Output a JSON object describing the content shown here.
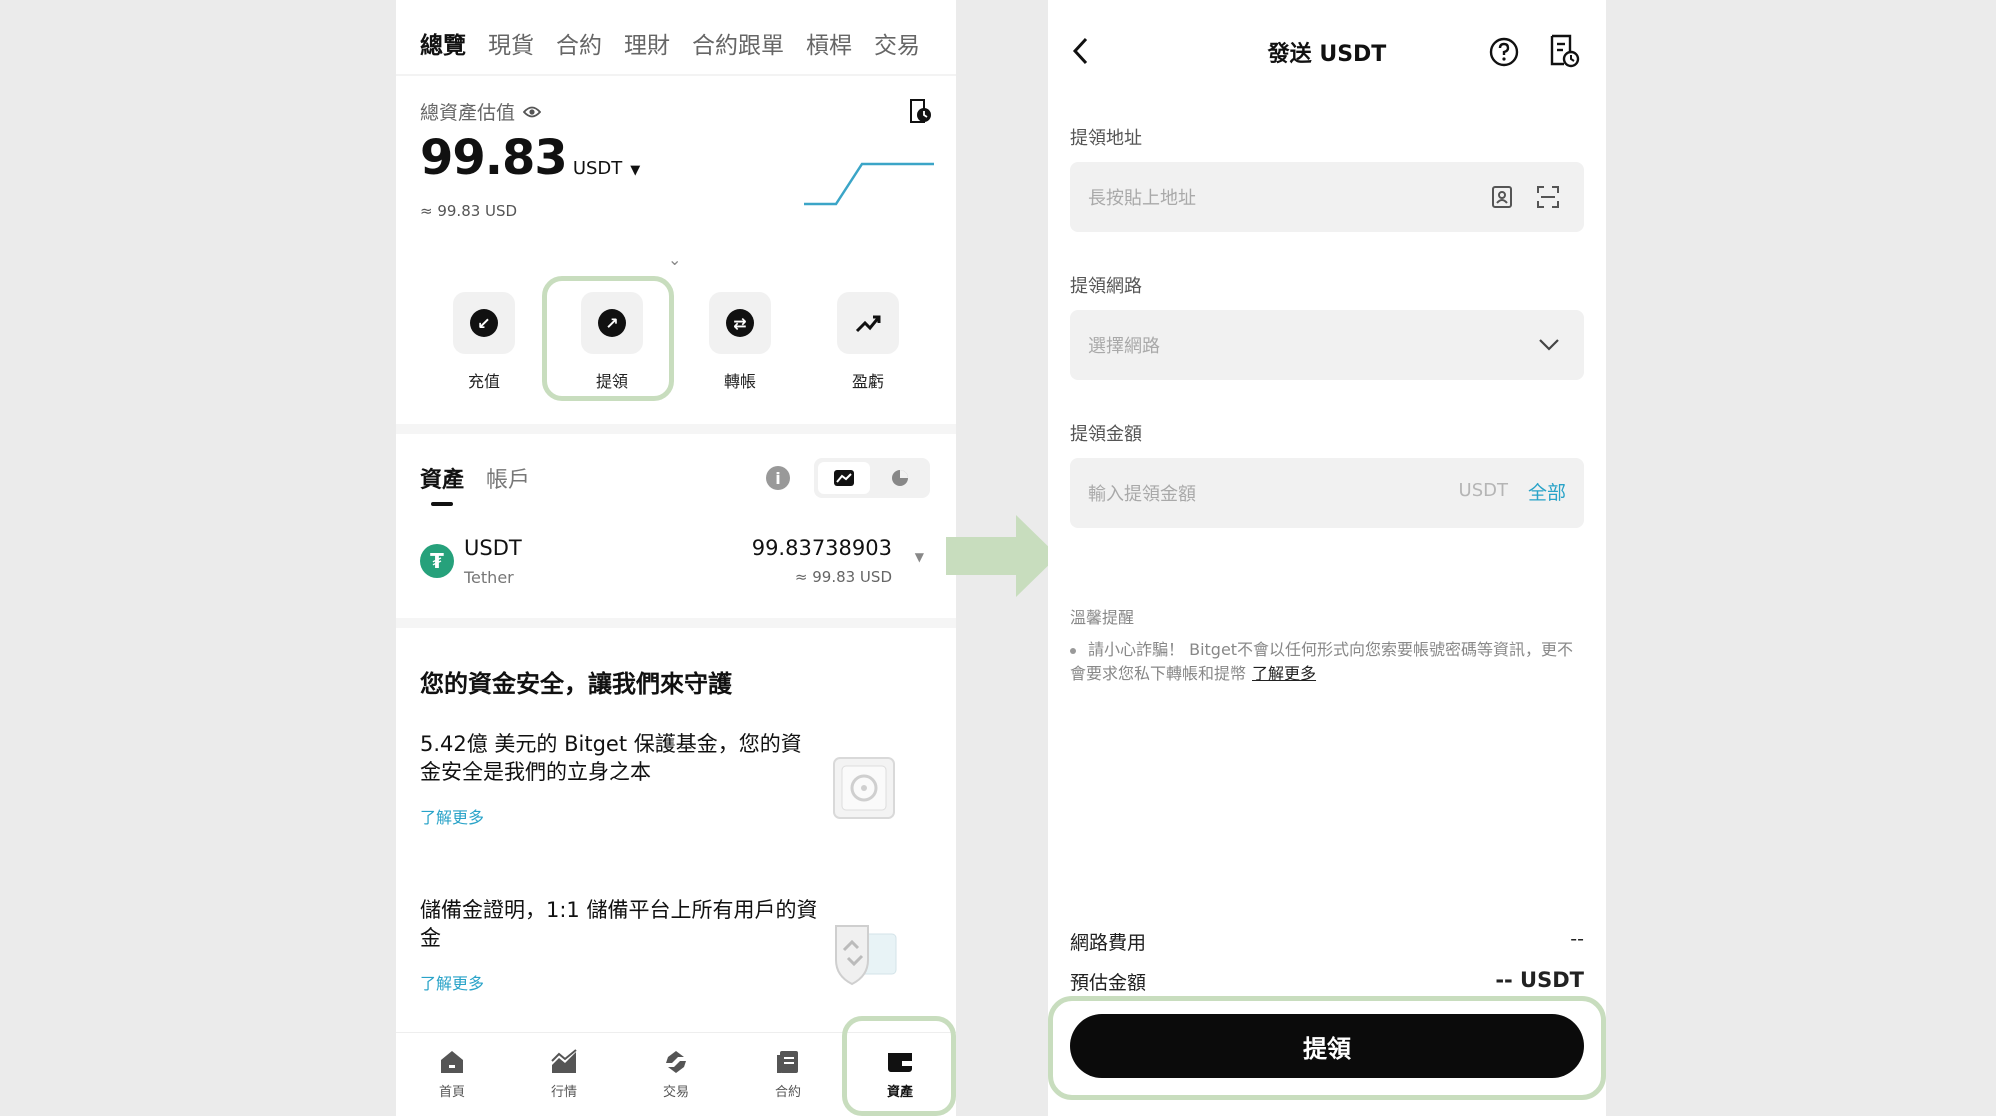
{
  "left": {
    "top_tabs": [
      "總覽",
      "現貨",
      "合約",
      "理財",
      "合約跟單",
      "槓桿",
      "交易"
    ],
    "active_top_tab": "總覽",
    "estimate_label": "總資產估值",
    "balance": "99.83",
    "balance_unit": "USDT",
    "balance_approx": "≈ 99.83 USD",
    "actions": [
      {
        "label": "充值",
        "icon": "deposit-icon"
      },
      {
        "label": "提領",
        "icon": "withdraw-icon"
      },
      {
        "label": "轉帳",
        "icon": "transfer-icon"
      },
      {
        "label": "盈虧",
        "icon": "pnl-icon"
      }
    ],
    "section_tabs": [
      "資產",
      "帳戶"
    ],
    "asset": {
      "symbol": "USDT",
      "name": "Tether",
      "amount": "99.83738903",
      "usd": "≈ 99.83 USD"
    },
    "safety_title": "您的資金安全，讓我們來守護",
    "features": [
      {
        "text": "5.42億 美元的 Bitget 保護基金，您的資金安全是我們的立身之本",
        "more": "了解更多"
      },
      {
        "text": "儲備金證明，1:1 儲備平台上所有用戶的資金",
        "more": "了解更多"
      }
    ],
    "bottom_tabs": [
      {
        "label": "首頁",
        "icon": "home-icon"
      },
      {
        "label": "行情",
        "icon": "market-icon"
      },
      {
        "label": "交易",
        "icon": "trade-icon"
      },
      {
        "label": "合約",
        "icon": "futures-icon"
      },
      {
        "label": "資產",
        "icon": "wallet-icon"
      }
    ],
    "active_bottom_tab": "資產"
  },
  "right": {
    "title": "發送 USDT",
    "address_label": "提領地址",
    "address_placeholder": "長按貼上地址",
    "network_label": "提領網路",
    "network_placeholder": "選擇網路",
    "amount_label": "提領金額",
    "amount_placeholder": "輸入提領金額",
    "amount_unit": "USDT",
    "amount_all": "全部",
    "tips_title": "溫馨提醒",
    "tips_text": "請小心詐騙！ Bitget不會以任何形式向您索要帳號密碼等資訊，更不會要求您私下轉帳和提幣",
    "tips_link": "了解更多",
    "fee_label": "網路費用",
    "fee_value": "--",
    "estimate_label": "預估金額",
    "estimate_value": "-- USDT",
    "submit_label": "提領"
  },
  "colors": {
    "highlight": "#c8ddbe",
    "accent_link": "#29a3c8",
    "tether_green": "#26a17b",
    "sparkline": "#3ba5c7"
  }
}
